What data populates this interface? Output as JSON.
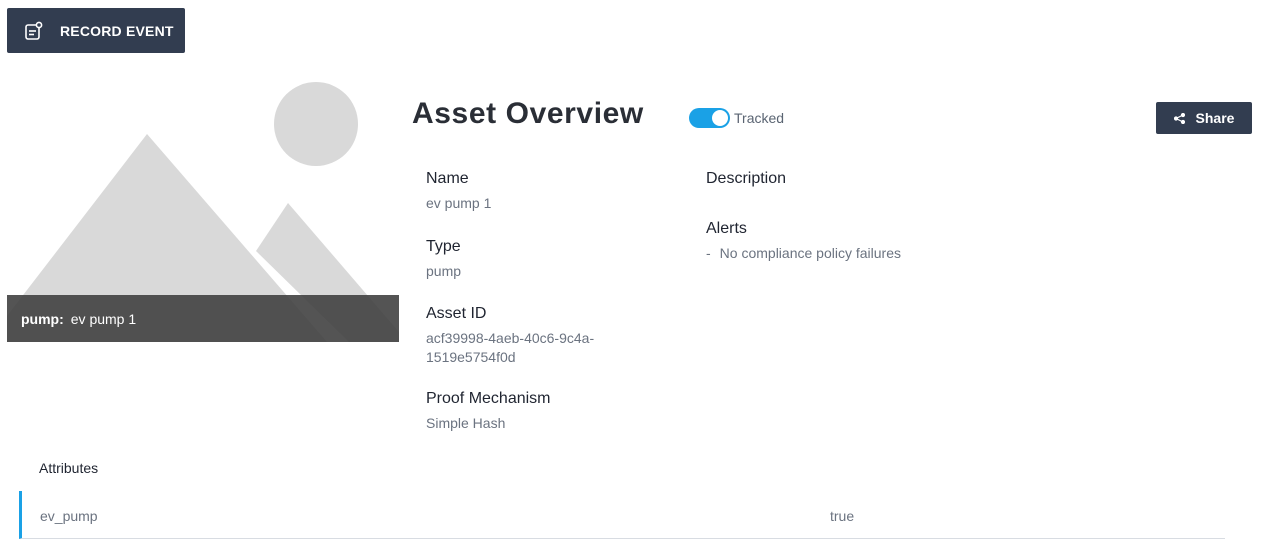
{
  "toolbar": {
    "record_label": "RECORD EVENT",
    "record_icon": "record-event-icon"
  },
  "hero": {
    "image_icon": "image-placeholder-icon",
    "caption_type": "pump:",
    "caption_name": "ev pump 1"
  },
  "header": {
    "title": "Asset Overview",
    "tracked_label": "Tracked",
    "tracked_on": true,
    "share_label": "Share",
    "share_icon": "share-icon"
  },
  "details": {
    "name_label": "Name",
    "name_value": "ev pump 1",
    "type_label": "Type",
    "type_value": "pump",
    "id_label": "Asset ID",
    "id_value": "acf39998-4aeb-40c6-9c4a-1519e5754f0d",
    "proof_label": "Proof Mechanism",
    "proof_value": "Simple Hash",
    "description_label": "Description",
    "alerts_label": "Alerts",
    "alerts_dash": "-",
    "alerts_value": "No compliance policy failures"
  },
  "attributes": {
    "heading": "Attributes",
    "rows": [
      {
        "key": "ev_pump",
        "value": "true"
      }
    ]
  },
  "colors": {
    "button_bg": "#323d50",
    "accent": "#1aa1e6",
    "placeholder": "#d9d9d9"
  }
}
